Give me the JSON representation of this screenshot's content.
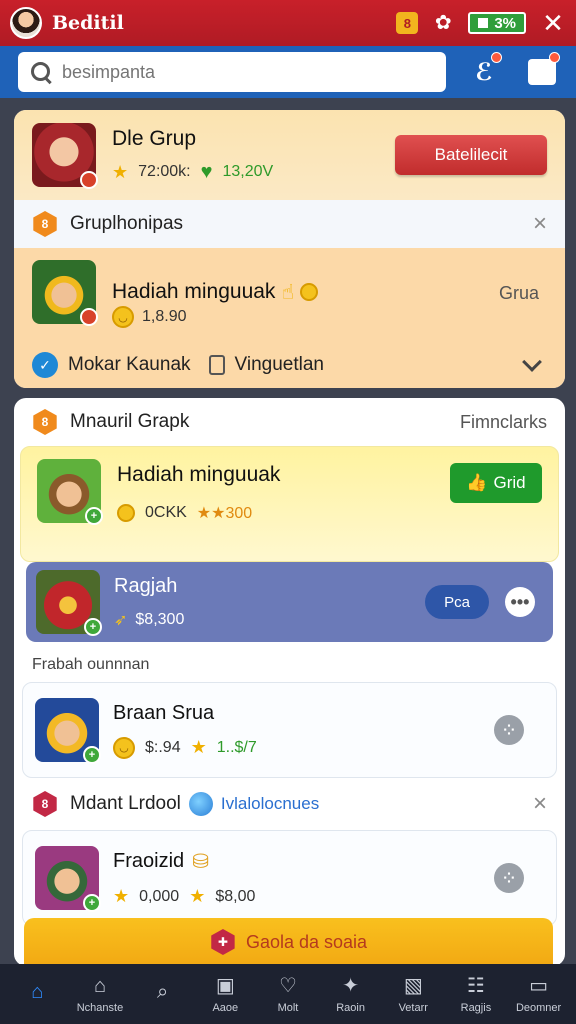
{
  "status_bar": {
    "app_title": "Beditil",
    "battery": "3%",
    "badge_glyph": "8",
    "flower_glyph": "✿",
    "close_glyph": "✕"
  },
  "search": {
    "placeholder": "besimpanta",
    "value": ""
  },
  "header": {
    "left_icon_glyph": "ℰ"
  },
  "card1": {
    "top": {
      "name": "Dle Grup",
      "points": "72:00k:",
      "green_value": "13,20V",
      "button": "Batelilecit"
    },
    "group": {
      "label": "Gruplhonipas",
      "icon_glyph": "8",
      "close_glyph": "×"
    },
    "mid": {
      "name": "Hadiah minguuak",
      "coins": "1,8.90",
      "ghost_button": "Grua",
      "footer_label": "Mokar Kaunak",
      "footer_label2": "Vinguetlan"
    }
  },
  "card2": {
    "head": {
      "label": "Mnauril Grapk",
      "icon_glyph": "8",
      "right": "Fimnclarks"
    },
    "yellow": {
      "name": "Hadiah minguuak",
      "stats_prefix": "0CKK",
      "stats_value": "★★300",
      "button": "Grid"
    },
    "purple": {
      "name": "Ragjah",
      "value": "$8,300",
      "pill": "Pca",
      "more_glyph": "•••"
    },
    "section_label": "Frabah ounnnan",
    "row1": {
      "name": "Braan Srua",
      "coin_value": "$:.94",
      "star_value": "1..$/7"
    },
    "group2": {
      "label": "Mdant Lrdool",
      "icon_glyph": "8",
      "link": "Ivlalolocnues",
      "close_glyph": "×"
    },
    "row2": {
      "name": "Fraoizid",
      "value1": "0,000",
      "value2": "$8,00"
    },
    "bottom_button": "Gaola da soaia",
    "bottom_button_glyph": "✚"
  },
  "bottom_nav": [
    {
      "label": "",
      "glyph": "⌂"
    },
    {
      "label": "Nchanste",
      "glyph": "⌂"
    },
    {
      "label": "",
      "glyph": "⌕"
    },
    {
      "label": "Aaoe",
      "glyph": "▣"
    },
    {
      "label": "Molt",
      "glyph": "♡"
    },
    {
      "label": "Raoin",
      "glyph": "✦"
    },
    {
      "label": "Vetarr",
      "glyph": "▧"
    },
    {
      "label": "Ragjis",
      "glyph": "☷"
    },
    {
      "label": "Deomner",
      "glyph": "▭"
    }
  ],
  "colors": {
    "status_red": "#c8202a",
    "header_blue": "#1f62b8",
    "action_red": "#c12c2c",
    "action_green": "#1f9a2c",
    "accent_yellow": "#f9c01e"
  }
}
